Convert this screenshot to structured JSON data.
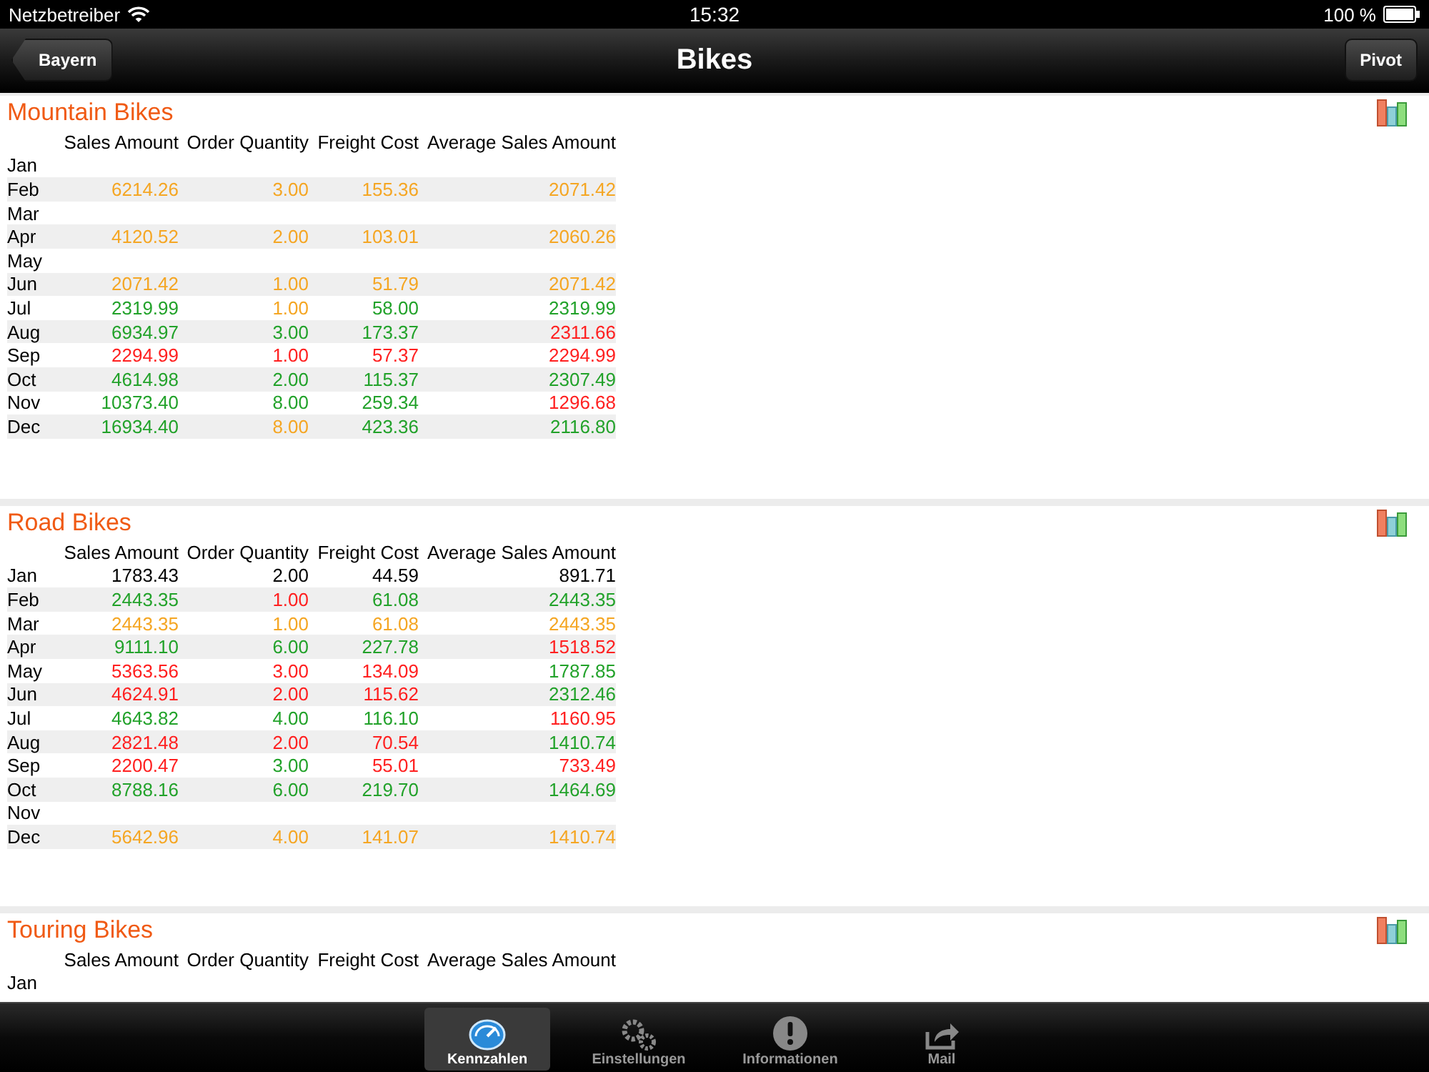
{
  "status_bar": {
    "carrier": "Netzbetreiber",
    "time": "15:32",
    "battery": "100 %"
  },
  "nav_bar": {
    "back": "Bayern",
    "title": "Bikes",
    "action": "Pivot"
  },
  "sections": [
    {
      "title": "Mountain Bikes",
      "columns": [
        "Sales Amount",
        "Order Quantity",
        "Freight Cost",
        "Average Sales Amount"
      ],
      "rows": [
        {
          "month": "Jan",
          "cells": []
        },
        {
          "month": "Feb",
          "cells": [
            {
              "value": "6214.26",
              "color": "#f5a623"
            },
            {
              "value": "3.00",
              "color": "#f5a623"
            },
            {
              "value": "155.36",
              "color": "#f5a623"
            },
            {
              "value": "2071.42",
              "color": "#f5a623"
            }
          ]
        },
        {
          "month": "Mar",
          "cells": []
        },
        {
          "month": "Apr",
          "cells": [
            {
              "value": "4120.52",
              "color": "#f5a623"
            },
            {
              "value": "2.00",
              "color": "#f5a623"
            },
            {
              "value": "103.01",
              "color": "#f5a623"
            },
            {
              "value": "2060.26",
              "color": "#f5a623"
            }
          ]
        },
        {
          "month": "May",
          "cells": []
        },
        {
          "month": "Jun",
          "cells": [
            {
              "value": "2071.42",
              "color": "#f5a623"
            },
            {
              "value": "1.00",
              "color": "#f5a623"
            },
            {
              "value": "51.79",
              "color": "#f5a623"
            },
            {
              "value": "2071.42",
              "color": "#f5a623"
            }
          ]
        },
        {
          "month": "Jul",
          "cells": [
            {
              "value": "2319.99",
              "color": "#22a22a"
            },
            {
              "value": "1.00",
              "color": "#f5a623"
            },
            {
              "value": "58.00",
              "color": "#22a22a"
            },
            {
              "value": "2319.99",
              "color": "#22a22a"
            }
          ]
        },
        {
          "month": "Aug",
          "cells": [
            {
              "value": "6934.97",
              "color": "#22a22a"
            },
            {
              "value": "3.00",
              "color": "#22a22a"
            },
            {
              "value": "173.37",
              "color": "#22a22a"
            },
            {
              "value": "2311.66",
              "color": "#ff2020"
            }
          ]
        },
        {
          "month": "Sep",
          "cells": [
            {
              "value": "2294.99",
              "color": "#ff2020"
            },
            {
              "value": "1.00",
              "color": "#ff2020"
            },
            {
              "value": "57.37",
              "color": "#ff2020"
            },
            {
              "value": "2294.99",
              "color": "#ff2020"
            }
          ]
        },
        {
          "month": "Oct",
          "cells": [
            {
              "value": "4614.98",
              "color": "#22a22a"
            },
            {
              "value": "2.00",
              "color": "#22a22a"
            },
            {
              "value": "115.37",
              "color": "#22a22a"
            },
            {
              "value": "2307.49",
              "color": "#22a22a"
            }
          ]
        },
        {
          "month": "Nov",
          "cells": [
            {
              "value": "10373.40",
              "color": "#22a22a"
            },
            {
              "value": "8.00",
              "color": "#22a22a"
            },
            {
              "value": "259.34",
              "color": "#22a22a"
            },
            {
              "value": "1296.68",
              "color": "#ff2020"
            }
          ]
        },
        {
          "month": "Dec",
          "cells": [
            {
              "value": "16934.40",
              "color": "#22a22a"
            },
            {
              "value": "8.00",
              "color": "#f5a623"
            },
            {
              "value": "423.36",
              "color": "#22a22a"
            },
            {
              "value": "2116.80",
              "color": "#22a22a"
            }
          ]
        }
      ]
    },
    {
      "title": "Road Bikes",
      "columns": [
        "Sales Amount",
        "Order Quantity",
        "Freight Cost",
        "Average Sales Amount"
      ],
      "rows": [
        {
          "month": "Jan",
          "cells": [
            {
              "value": "1783.43",
              "color": "#000000"
            },
            {
              "value": "2.00",
              "color": "#000000"
            },
            {
              "value": "44.59",
              "color": "#000000"
            },
            {
              "value": "891.71",
              "color": "#000000"
            }
          ]
        },
        {
          "month": "Feb",
          "cells": [
            {
              "value": "2443.35",
              "color": "#22a22a"
            },
            {
              "value": "1.00",
              "color": "#ff2020"
            },
            {
              "value": "61.08",
              "color": "#22a22a"
            },
            {
              "value": "2443.35",
              "color": "#22a22a"
            }
          ]
        },
        {
          "month": "Mar",
          "cells": [
            {
              "value": "2443.35",
              "color": "#f5a623"
            },
            {
              "value": "1.00",
              "color": "#f5a623"
            },
            {
              "value": "61.08",
              "color": "#f5a623"
            },
            {
              "value": "2443.35",
              "color": "#f5a623"
            }
          ]
        },
        {
          "month": "Apr",
          "cells": [
            {
              "value": "9111.10",
              "color": "#22a22a"
            },
            {
              "value": "6.00",
              "color": "#22a22a"
            },
            {
              "value": "227.78",
              "color": "#22a22a"
            },
            {
              "value": "1518.52",
              "color": "#ff2020"
            }
          ]
        },
        {
          "month": "May",
          "cells": [
            {
              "value": "5363.56",
              "color": "#ff2020"
            },
            {
              "value": "3.00",
              "color": "#ff2020"
            },
            {
              "value": "134.09",
              "color": "#ff2020"
            },
            {
              "value": "1787.85",
              "color": "#22a22a"
            }
          ]
        },
        {
          "month": "Jun",
          "cells": [
            {
              "value": "4624.91",
              "color": "#ff2020"
            },
            {
              "value": "2.00",
              "color": "#ff2020"
            },
            {
              "value": "115.62",
              "color": "#ff2020"
            },
            {
              "value": "2312.46",
              "color": "#22a22a"
            }
          ]
        },
        {
          "month": "Jul",
          "cells": [
            {
              "value": "4643.82",
              "color": "#22a22a"
            },
            {
              "value": "4.00",
              "color": "#22a22a"
            },
            {
              "value": "116.10",
              "color": "#22a22a"
            },
            {
              "value": "1160.95",
              "color": "#ff2020"
            }
          ]
        },
        {
          "month": "Aug",
          "cells": [
            {
              "value": "2821.48",
              "color": "#ff2020"
            },
            {
              "value": "2.00",
              "color": "#ff2020"
            },
            {
              "value": "70.54",
              "color": "#ff2020"
            },
            {
              "value": "1410.74",
              "color": "#22a22a"
            }
          ]
        },
        {
          "month": "Sep",
          "cells": [
            {
              "value": "2200.47",
              "color": "#ff2020"
            },
            {
              "value": "3.00",
              "color": "#22a22a"
            },
            {
              "value": "55.01",
              "color": "#ff2020"
            },
            {
              "value": "733.49",
              "color": "#ff2020"
            }
          ]
        },
        {
          "month": "Oct",
          "cells": [
            {
              "value": "8788.16",
              "color": "#22a22a"
            },
            {
              "value": "6.00",
              "color": "#22a22a"
            },
            {
              "value": "219.70",
              "color": "#22a22a"
            },
            {
              "value": "1464.69",
              "color": "#22a22a"
            }
          ]
        },
        {
          "month": "Nov",
          "cells": []
        },
        {
          "month": "Dec",
          "cells": [
            {
              "value": "5642.96",
              "color": "#f5a623"
            },
            {
              "value": "4.00",
              "color": "#f5a623"
            },
            {
              "value": "141.07",
              "color": "#f5a623"
            },
            {
              "value": "1410.74",
              "color": "#f5a623"
            }
          ]
        }
      ]
    },
    {
      "title": "Touring Bikes",
      "columns": [
        "Sales Amount",
        "Order Quantity",
        "Freight Cost",
        "Average Sales Amount"
      ],
      "rows": [
        {
          "month": "Jan",
          "cells": []
        }
      ]
    }
  ],
  "tab_bar": [
    {
      "label": "Kennzahlen",
      "selected": true
    },
    {
      "label": "Einstellungen",
      "selected": false
    },
    {
      "label": "Informationen",
      "selected": false
    },
    {
      "label": "Mail",
      "selected": false
    }
  ]
}
